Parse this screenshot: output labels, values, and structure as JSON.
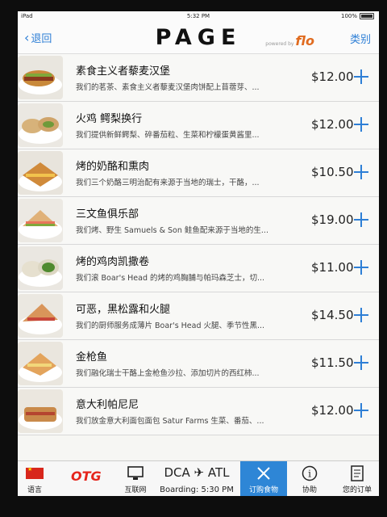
{
  "status": {
    "device": "iPad",
    "time": "5:32 PM",
    "battery": "100%"
  },
  "nav": {
    "back_label": "退回",
    "brand": "PAGE",
    "powered_by": "powered by",
    "flo": "flo",
    "categories_label": "类别"
  },
  "menu": [
    {
      "title": "素食主义者藜麦汉堡",
      "desc": "我们的茗茶、素食主义者藜麦汉堡肉饼配上苜蓿芽、...",
      "price": "$12.00"
    },
    {
      "title": "火鸡 鳄梨换行",
      "desc": "我们提供新鲜鳄梨、碎番茄粒、生菜和柠檬蛋黄酱里...",
      "price": "$12.00"
    },
    {
      "title": "烤的奶酪和熏肉",
      "desc": "我们三个奶酪三明治配有来源于当地的瑞士，干酪，...",
      "price": "$10.50"
    },
    {
      "title": "三文鱼俱乐部",
      "desc": "我们烤、野生 Samuels & Son 鲑鱼配来源于当地的生...",
      "price": "$19.00"
    },
    {
      "title": "烤的鸡肉凯撒卷",
      "desc": "我们滚 Boar's Head 的烤的鸡胸脯与帕玛森芝士，切...",
      "price": "$11.00"
    },
    {
      "title": "可恶，黑松露和火腿",
      "desc": "我们的厨师服务成薄片 Boar's Head 火腿、季节性黑...",
      "price": "$14.50"
    },
    {
      "title": "金枪鱼",
      "desc": "我们融化瑞士干酪上金枪鱼沙拉、添加切片的西红柿...",
      "price": "$11.50"
    },
    {
      "title": "意大利帕尼尼",
      "desc": "我们放金意大利面包面包 Satur Farms 生菜、番茄、...",
      "price": "$12.00"
    }
  ],
  "tabs": {
    "language": "语言",
    "otg": "OTG",
    "internet": "互联网",
    "route_from": "DCA",
    "route_to": "ATL",
    "boarding": "Boarding: 5:30 PM",
    "order_food": "订购食物",
    "help": "协助",
    "my_order": "您的订单"
  },
  "colors": {
    "accent": "#2e7fd6",
    "active_tab": "#2e86d6",
    "otg_red": "#e5241b",
    "flo_orange": "#e06b1f"
  }
}
